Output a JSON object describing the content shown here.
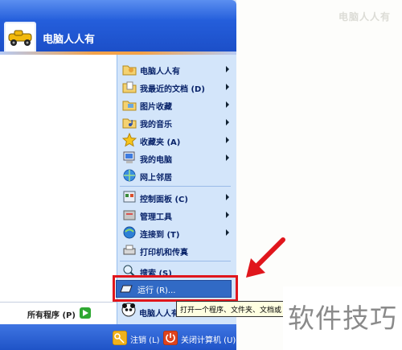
{
  "watermark_top": "电脑人人有",
  "watermark_bottom": "软件技巧",
  "user": {
    "name": "电脑人人有"
  },
  "all_programs": {
    "label": "所有程序 (P)"
  },
  "right_items": [
    {
      "label": "电脑人人有",
      "icon": "user-folder-icon",
      "arrow": true
    },
    {
      "label": "我最近的文档 (D)",
      "icon": "recent-docs-icon",
      "arrow": true
    },
    {
      "label": "图片收藏",
      "icon": "pictures-folder-icon",
      "arrow": true
    },
    {
      "label": "我的音乐",
      "icon": "music-folder-icon",
      "arrow": true
    },
    {
      "label": "收藏夹 (A)",
      "icon": "favorites-star-icon",
      "arrow": true
    },
    {
      "label": "我的电脑",
      "icon": "my-computer-icon",
      "arrow": true
    },
    {
      "label": "网上邻居",
      "icon": "network-icon",
      "arrow": false
    },
    {
      "label": "控制面板 (C)",
      "icon": "control-panel-icon",
      "arrow": true
    },
    {
      "label": "管理工具",
      "icon": "admin-tools-icon",
      "arrow": true
    },
    {
      "label": "连接到 (T)",
      "icon": "connect-to-icon",
      "arrow": true
    },
    {
      "label": "打印机和传真",
      "icon": "printer-icon",
      "arrow": false
    },
    {
      "label": "搜索 (S)",
      "icon": "search-icon",
      "arrow": false
    }
  ],
  "run": {
    "label": "运行 (R)..."
  },
  "last_item": {
    "label": "电脑人人有"
  },
  "tooltip": "打开一个程序、文件夹、文档或",
  "footer": {
    "logoff": "注销 (L)",
    "shutdown": "关闭计算机 (U)"
  },
  "colors": {
    "header": "#245edb",
    "highlight": "#316ac5",
    "annotation": "#e0161c"
  }
}
